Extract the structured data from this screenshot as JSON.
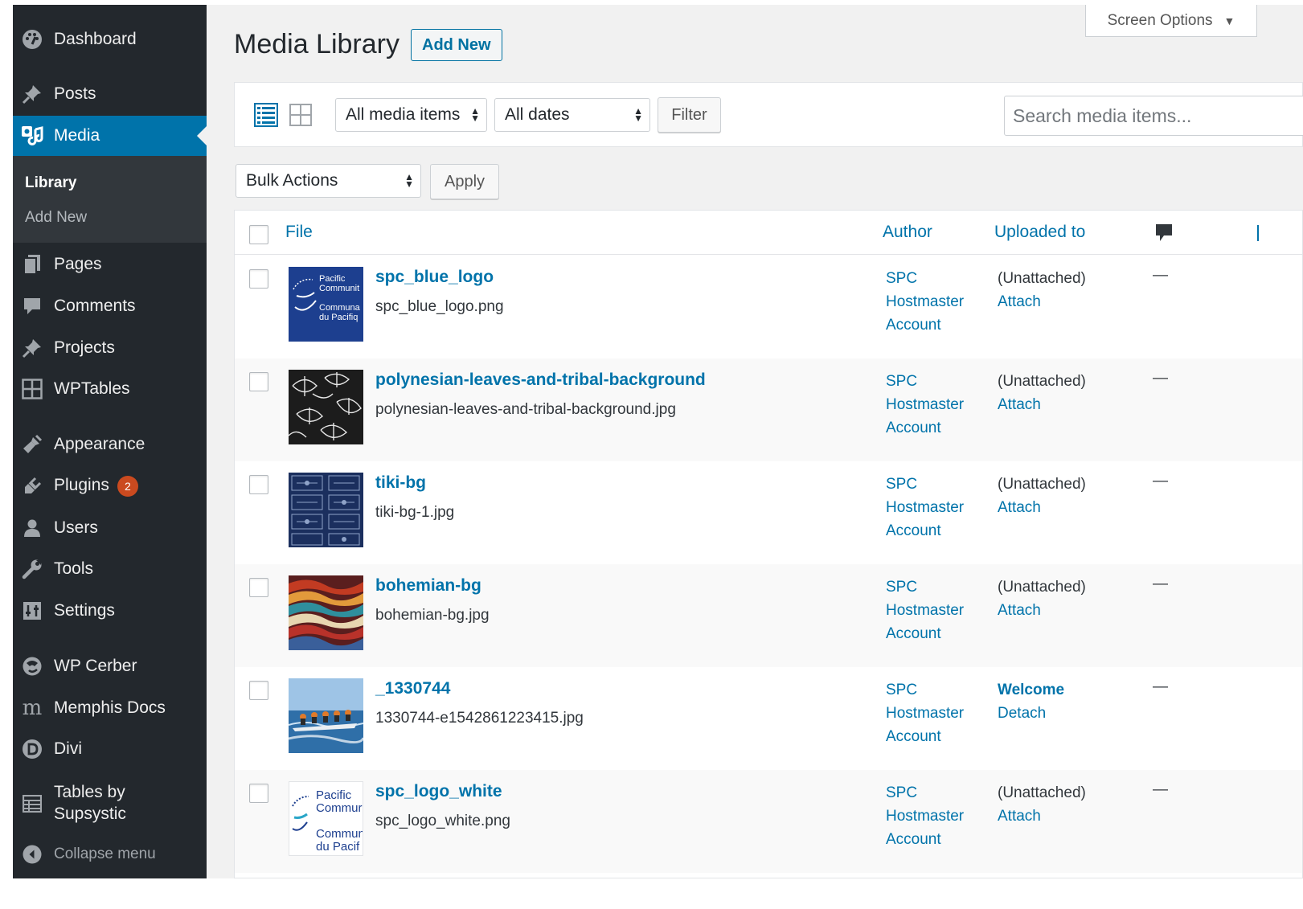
{
  "sidebar": {
    "items": [
      {
        "label": "Dashboard",
        "icon": "dashboard-icon"
      },
      {
        "label": "Posts",
        "icon": "pin-icon"
      },
      {
        "label": "Media",
        "icon": "media-icon"
      },
      {
        "label": "Pages",
        "icon": "pages-icon"
      },
      {
        "label": "Comments",
        "icon": "comment-icon"
      },
      {
        "label": "Projects",
        "icon": "pin-icon"
      },
      {
        "label": "WPTables",
        "icon": "grid-icon"
      },
      {
        "label": "Appearance",
        "icon": "brush-icon"
      },
      {
        "label": "Plugins",
        "icon": "plugin-icon",
        "badge": "2"
      },
      {
        "label": "Users",
        "icon": "user-icon"
      },
      {
        "label": "Tools",
        "icon": "wrench-icon"
      },
      {
        "label": "Settings",
        "icon": "settings-icon"
      },
      {
        "label": "WP Cerber",
        "icon": "cerber-icon"
      },
      {
        "label": "Memphis Docs",
        "icon": "memphis-icon"
      },
      {
        "label": "Divi",
        "icon": "divi-icon"
      },
      {
        "label": "Tables by",
        "label2": "Supsystic",
        "icon": "table-icon"
      },
      {
        "label": "Collapse menu",
        "icon": "collapse-icon"
      }
    ],
    "submenu": {
      "library": "Library",
      "add_new": "Add New"
    }
  },
  "header": {
    "title": "Media Library",
    "add_new": "Add New",
    "screen_options": "Screen Options"
  },
  "toolbar": {
    "media_filter": "All media items",
    "date_filter": "All dates",
    "filter_button": "Filter",
    "search_placeholder": "Search media items..."
  },
  "bulk": {
    "action": "Bulk Actions",
    "apply": "Apply"
  },
  "table": {
    "columns": {
      "file": "File",
      "author": "Author",
      "uploaded_to": "Uploaded to"
    },
    "rows": [
      {
        "title": "spc_blue_logo",
        "filename": "spc_blue_logo.png",
        "author": [
          "SPC",
          "Hostmaster",
          "Account"
        ],
        "uploaded": "(Unattached)",
        "action": "Attach",
        "comments": "—",
        "thumb": "spc-blue",
        "thumb_lines": [
          "Pacific",
          "Communit",
          "Communa",
          "du Pacifiq"
        ]
      },
      {
        "title": "polynesian-leaves-and-tribal-background",
        "filename": "polynesian-leaves-and-tribal-background.jpg",
        "author": [
          "SPC",
          "Hostmaster",
          "Account"
        ],
        "uploaded": "(Unattached)",
        "action": "Attach",
        "comments": "—",
        "thumb": "leaves"
      },
      {
        "title": "tiki-bg",
        "filename": "tiki-bg-1.jpg",
        "author": [
          "SPC",
          "Hostmaster",
          "Account"
        ],
        "uploaded": "(Unattached)",
        "action": "Attach",
        "comments": "—",
        "thumb": "tiki"
      },
      {
        "title": "bohemian-bg",
        "filename": "bohemian-bg.jpg",
        "author": [
          "SPC",
          "Hostmaster",
          "Account"
        ],
        "uploaded": "(Unattached)",
        "action": "Attach",
        "comments": "—",
        "thumb": "bohemian"
      },
      {
        "title": "_1330744",
        "filename": "1330744-e1542861223415.jpg",
        "author": [
          "SPC",
          "Hostmaster",
          "Account"
        ],
        "uploaded": "Welcome",
        "uploaded_is_link": true,
        "action": "Detach",
        "comments": "—",
        "thumb": "canoe"
      },
      {
        "title": "spc_logo_white",
        "filename": "spc_logo_white.png",
        "author": [
          "SPC",
          "Hostmaster",
          "Account"
        ],
        "uploaded": "(Unattached)",
        "action": "Attach",
        "comments": "—",
        "thumb": "spc-white",
        "thumb_lines": [
          "Pacific",
          "Commur",
          "Commun",
          "du Pacif"
        ]
      }
    ]
  },
  "colors": {
    "sidebar_bg": "#23282d",
    "active": "#0073aa",
    "link": "#0073aa",
    "badge": "#ca4a1f"
  }
}
